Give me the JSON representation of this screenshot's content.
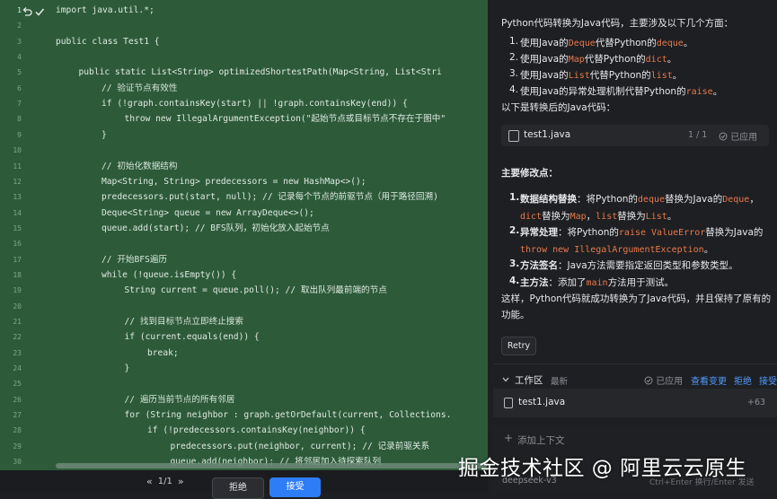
{
  "editor": {
    "line_numbers": [
      "1",
      "2",
      "3",
      "4",
      "5",
      "6",
      "7",
      "8",
      "9",
      "10",
      "11",
      "12",
      "13",
      "14",
      "15",
      "16",
      "17",
      "18",
      "19",
      "20",
      "21",
      "22",
      "23",
      "24",
      "25",
      "26",
      "27",
      "28",
      "29",
      "30"
    ],
    "code_lines": [
      {
        "text": "import java.util.*;",
        "indent": 0,
        "comment": false
      },
      {
        "text": "",
        "indent": 0,
        "comment": false
      },
      {
        "text": "public class Test1 {",
        "indent": 0,
        "comment": false
      },
      {
        "text": "",
        "indent": 0,
        "comment": false
      },
      {
        "text": "public static List<String> optimizedShortestPath(Map<String, List<Stri",
        "indent": 1,
        "comment": false
      },
      {
        "text": "// 验证节点有效性",
        "indent": 2,
        "comment": true
      },
      {
        "text": "if (!graph.containsKey(start) || !graph.containsKey(end)) {",
        "indent": 2,
        "comment": false
      },
      {
        "text": "throw new IllegalArgumentException(\"起始节点或目标节点不存在于图中\"",
        "indent": 3,
        "comment": false
      },
      {
        "text": "}",
        "indent": 2,
        "comment": false
      },
      {
        "text": "",
        "indent": 0,
        "comment": false
      },
      {
        "text": "// 初始化数据结构",
        "indent": 2,
        "comment": true
      },
      {
        "text": "Map<String, String> predecessors = new HashMap<>();",
        "indent": 2,
        "comment": false
      },
      {
        "text": "predecessors.put(start, null); // 记录每个节点的前驱节点（用于路径回溯)",
        "indent": 2,
        "comment": false
      },
      {
        "text": "Deque<String> queue = new ArrayDeque<>();",
        "indent": 2,
        "comment": false
      },
      {
        "text": "queue.add(start); // BFS队列，初始化放入起始节点",
        "indent": 2,
        "comment": false
      },
      {
        "text": "",
        "indent": 0,
        "comment": false
      },
      {
        "text": "// 开始BFS遍历",
        "indent": 2,
        "comment": true
      },
      {
        "text": "while (!queue.isEmpty()) {",
        "indent": 2,
        "comment": false
      },
      {
        "text": "String current = queue.poll(); // 取出队列最前端的节点",
        "indent": 3,
        "comment": false
      },
      {
        "text": "",
        "indent": 0,
        "comment": false
      },
      {
        "text": "// 找到目标节点立即终止搜索",
        "indent": 3,
        "comment": true
      },
      {
        "text": "if (current.equals(end)) {",
        "indent": 3,
        "comment": false
      },
      {
        "text": "break;",
        "indent": 4,
        "comment": false
      },
      {
        "text": "}",
        "indent": 3,
        "comment": false
      },
      {
        "text": "",
        "indent": 0,
        "comment": false
      },
      {
        "text": "// 遍历当前节点的所有邻居",
        "indent": 3,
        "comment": true
      },
      {
        "text": "for (String neighbor : graph.getOrDefault(current, Collections.",
        "indent": 3,
        "comment": false
      },
      {
        "text": "if (!predecessors.containsKey(neighbor)) {",
        "indent": 4,
        "comment": false
      },
      {
        "text": "predecessors.put(neighbor, current); // 记录前驱关系",
        "indent": 5,
        "comment": false
      },
      {
        "text": "queue.add(neighbor); // 将邻居加入待探索队列",
        "indent": 5,
        "comment": false
      }
    ],
    "bar": {
      "pager": "1/1",
      "reject": "拒绝",
      "accept": "接受"
    }
  },
  "chat": {
    "intro": "Python代码转换为Java代码，主要涉及以下几个方面：",
    "list1": [
      [
        "使用Java的",
        "Deque",
        "代替Python的",
        "deque",
        "。"
      ],
      [
        "使用Java的",
        "Map",
        "代替Python的",
        "dict",
        "。"
      ],
      [
        "使用Java的",
        "List",
        "代替Python的",
        "list",
        "。"
      ],
      [
        "使用Java的异常处理机制代替Python的",
        "raise",
        "。",
        "",
        ""
      ]
    ],
    "after_list": "以下是转换后的Java代码：",
    "file_card": {
      "name": "test1.java",
      "count": "1 / 1",
      "status": "已应用"
    },
    "heading": "主要修改点：",
    "items": [
      {
        "label": "数据结构替换",
        "parts": [
          "：将Python的",
          "deque",
          "替换为Java的",
          "Deque",
          "，"
        ]
      },
      {
        "label": "",
        "parts": [
          "dict",
          "替换为",
          "Map",
          "，",
          "list",
          "替换为",
          "List",
          "。"
        ]
      },
      {
        "label": "异常处理",
        "parts": [
          "：将Python的",
          "raise ValueError",
          "替换为Java的"
        ]
      },
      {
        "label": "",
        "parts": [
          "throw new IllegalArgumentException",
          "。"
        ]
      },
      {
        "label": "方法签名",
        "parts": [
          "：Java方法需要指定返回类型和参数类型。"
        ]
      },
      {
        "label": "主方法",
        "parts": [
          "：添加了",
          "main",
          "方法用于测试。"
        ]
      }
    ],
    "closing1": "这样，Python代码就成功转换为了Java代码，并且保持了原有的",
    "closing2": "功能。",
    "retry": "Retry",
    "workspace": {
      "title": "工作区",
      "latest": "最新",
      "applied": "已应用",
      "view": "查看变更",
      "reject": "拒绝",
      "accept": "接受",
      "file": "test1.java",
      "diff": "+63"
    },
    "add_context": "添加上下文",
    "model": "deepseek-v3",
    "hint": "Ctrl+Enter 换行/Enter 发送"
  },
  "watermark": "掘金技术社区 @ 阿里云云原生",
  "colors": {
    "editor_bg": "#2d5b3a",
    "keyword": "#e8794b",
    "accent": "#2f7df6"
  }
}
